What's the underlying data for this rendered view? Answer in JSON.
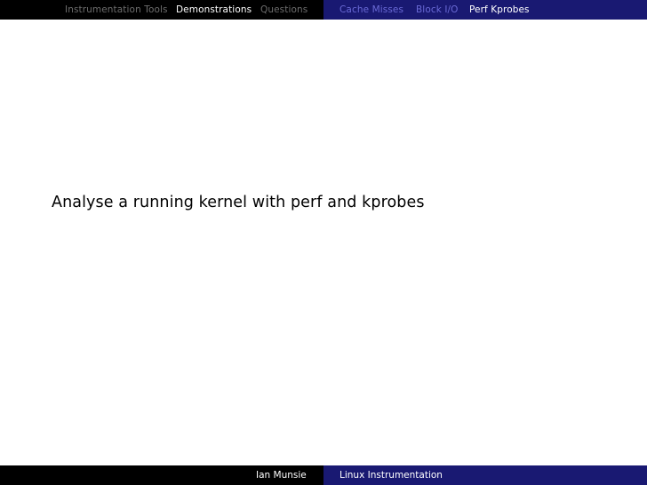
{
  "header": {
    "sections": [
      {
        "label": "Instrumentation Tools",
        "active": false
      },
      {
        "label": "Demonstrations",
        "active": true
      },
      {
        "label": "Questions",
        "active": false
      }
    ],
    "subsections": [
      {
        "label": "Cache Misses",
        "active": false
      },
      {
        "label": "Block I/O",
        "active": false
      },
      {
        "label": "Perf Kprobes",
        "active": true
      }
    ]
  },
  "slide": {
    "text": "Analyse a running kernel with perf and kprobes"
  },
  "footer": {
    "author": "Ian Munsie",
    "title": "Linux Instrumentation"
  },
  "colors": {
    "left_bar": "#000000",
    "right_bar": "#191972",
    "inactive_section": "#6d6d6d",
    "inactive_subsection": "#6a6ad6",
    "active": "#ffffff"
  }
}
